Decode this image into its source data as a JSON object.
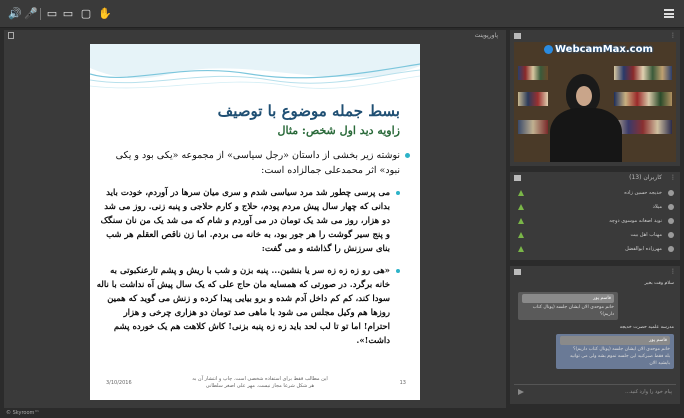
{
  "app": {
    "copyright": "© Skyroom™"
  },
  "toolbar": {
    "icons": [
      "speaker-icon",
      "microphone-icon",
      "video-icon",
      "screen-share-icon",
      "whiteboard-icon",
      "hand-raise-icon"
    ]
  },
  "main_panel": {
    "title": "پاورپوینت"
  },
  "slide": {
    "title": "بسط جمله موضوع با توصیف",
    "subtitle": "زاویه دید اول شخص: مثال",
    "intro": "نوشته زیر بخشی از داستان «رجل سیاسی» از مجموعه «یکی بود و یکی نبود» اثر محمدعلی جمالزاده است:",
    "para1": "می پرسی چطور شد مرد سیاسی شدم و سری میان سرها در آوردم، خودت باید بدانی که چهار سال پیش مردم پودم، حلاج و کارم حلاجی و پنبه زنی. روز می شد دو هزار، روز می شد یک تومان در می آوردم و شام که می شد یک من نان سنگک و پنج سیر گوشت را هر جور بود، به خانه می بردم. اما زن ناقص العقلم هر شب بنای سرزنش را گذاشته و می گفت:",
    "para2": "«هی رو زه زه زه سر یا بنشین... پنبه بزن و شب با ریش و پشم تارعنکبوتی به خانه برگرد. در صورتی که همسایه مان حاج علی که یک سال پیش آه نداشت با ناله سودا کند، کم کم داخل آدم شده و برو بیایی پیدا کرده و زنش می گوید که همین روزها هم وکیل مجلس می شود با ماهی صد تومان دو هزاری چرخی و هزار احترام! اما تو تا لب لحد باید زه زه پنبه بزنی! کاش کلاهت هم یک خورده پشم داشت!».",
    "footer_date": "3/10/2016",
    "footer_note": "این مطالب فقط برای استفاده شخصی است. چاپ و انتشار آن به هر شکل شرعا مجاز نیست. مهر علی اصغر سلطانی",
    "footer_page": "13"
  },
  "video_panel": {
    "watermark": "WebcamMax.com"
  },
  "users_panel": {
    "title": "کاربران (13)",
    "users": [
      {
        "name": "خدیجه حسین زاده"
      },
      {
        "name": "میلاد"
      },
      {
        "name": "نوید اصغانه موسوی دوچه"
      },
      {
        "name": "مهناب اهل بیت"
      },
      {
        "name": "مهرزاده ابوالفضل"
      }
    ]
  },
  "chat_panel": {
    "messages": [
      {
        "author": "سلام وقت بخیر"
      },
      {
        "quote": "قاسم پور",
        "text": "خانم موحدی الان ایشان جلسه (پونال کتاب داریم)؟"
      },
      {
        "author": "مدرسه علمیه حضرت خدیجه"
      },
      {
        "quote": "قاسم پور",
        "text": "خانم موحدی الان ایشان جلسه (پونال کتاب داریم)؟"
      },
      {
        "text": "بله فقط صبرکنید این جلسه تموم بشه ولی می توانید بایشید الان"
      }
    ],
    "input_placeholder": "پیام خود را وارد کنید..."
  }
}
